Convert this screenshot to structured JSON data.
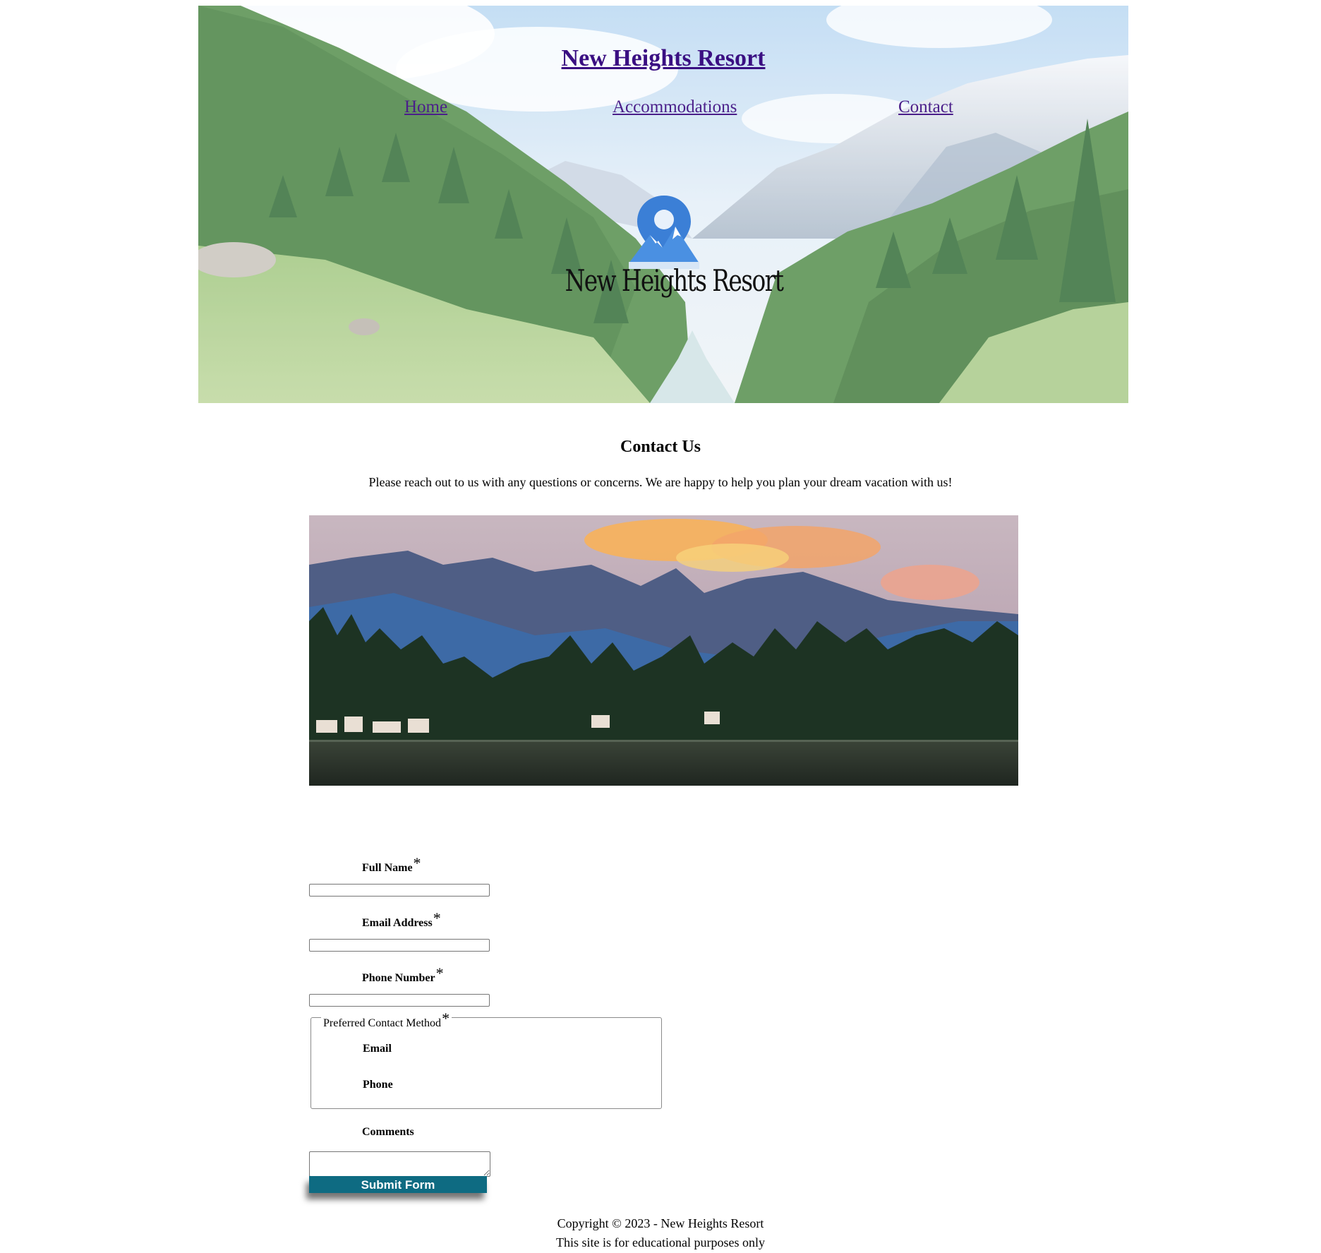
{
  "header": {
    "site_title": "New Heights Resort",
    "nav": [
      {
        "label": "Home"
      },
      {
        "label": "Accommodations"
      },
      {
        "label": "Contact"
      }
    ],
    "logo_text": "New Heights Resort"
  },
  "main": {
    "heading": "Contact Us",
    "intro": "Please reach out to us with any questions or concerns. We are happy to help you plan your dream vacation with us!"
  },
  "form": {
    "full_name_label": "Full Name",
    "email_label": "Email Address",
    "phone_label": "Phone Number",
    "required_marker": "*",
    "contact_method_legend": "Preferred Contact Method",
    "contact_options": [
      {
        "label": "Email"
      },
      {
        "label": "Phone"
      }
    ],
    "comments_label": "Comments",
    "submit_label": "Submit Form"
  },
  "footer": {
    "copyright": "Copyright © 2023 - New Heights Resort",
    "note": "This site is for educational purposes only"
  },
  "colors": {
    "link": "#4b1f8a",
    "title": "#3a0f82",
    "submit_bg": "#0e6b82",
    "logo_pin": "#3b7fd6"
  },
  "icons": {
    "logo": "map-pin-mountain-icon"
  }
}
